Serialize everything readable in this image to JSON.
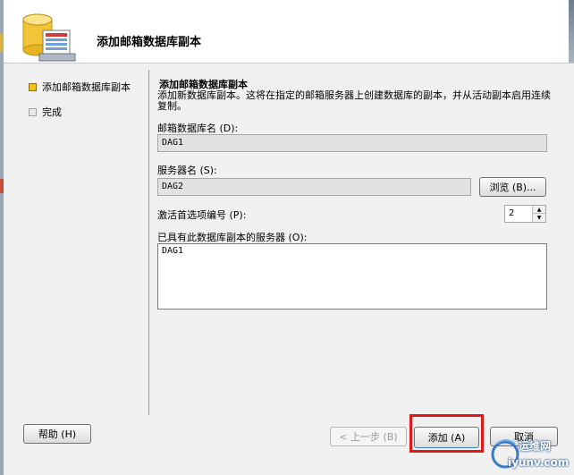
{
  "header": {
    "title": "添加邮箱数据库副本",
    "icon": "database-icon"
  },
  "sidebar": {
    "steps": [
      {
        "label": "添加邮箱数据库副本",
        "state": "active"
      },
      {
        "label": "完成",
        "state": "inactive"
      }
    ]
  },
  "main": {
    "section_title": "添加邮箱数据库副本",
    "description": "添加新数据库副本。这将在指定的邮箱服务器上创建数据库的副本，并从活动副本启用连续复制。",
    "database_name": {
      "label": "邮箱数据库名 (D):",
      "value": "DAG1"
    },
    "server_name": {
      "label": "服务器名 (S):",
      "value": "DAG2",
      "browse_label": "浏览 (B)..."
    },
    "activation_preference": {
      "label": "激活首选项编号 (P):",
      "value": "2"
    },
    "servers_with_copy": {
      "label": "已具有此数据库副本的服务器 (O):",
      "items": [
        "DAG1"
      ]
    }
  },
  "footer": {
    "help_label": "帮助 (H)",
    "back_label": "< 上一步 (B)",
    "add_label": "添加 (A)",
    "cancel_label": "取消"
  },
  "watermark": {
    "brand": "运维网",
    "url": "iyunv.com"
  },
  "colors": {
    "highlight": "#e01818",
    "active_step": "#f2c018"
  }
}
